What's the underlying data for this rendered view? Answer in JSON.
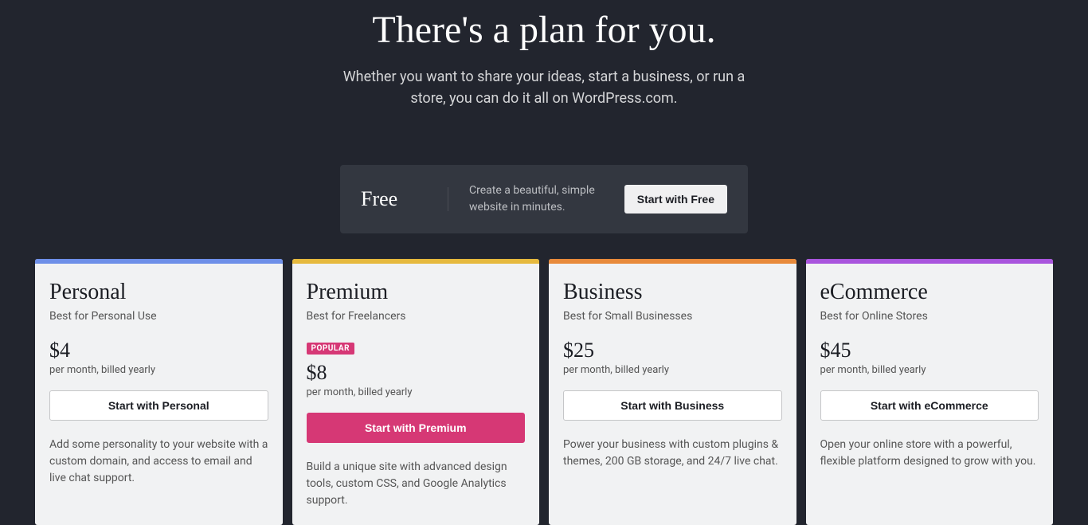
{
  "hero": {
    "title": "There's a plan for you.",
    "subtitle": "Whether you want to share your ideas, start a business, or run a store, you can do it all on WordPress.com."
  },
  "free": {
    "name": "Free",
    "desc": "Create a beautiful, simple website in minutes.",
    "cta": "Start with Free"
  },
  "plans": [
    {
      "name": "Personal",
      "tagline": "Best for Personal Use",
      "popular": false,
      "price": "$4",
      "billing": "per month, billed yearly",
      "cta": "Start with Personal",
      "desc": "Add some personality to your website with a custom domain, and access to email and live chat support.",
      "stripe": "personal-stripe",
      "highlighted": false
    },
    {
      "name": "Premium",
      "tagline": "Best for Freelancers",
      "popular": true,
      "popular_label": "POPULAR",
      "price": "$8",
      "billing": "per month, billed yearly",
      "cta": "Start with Premium",
      "desc": "Build a unique site with advanced design tools, custom CSS, and Google Analytics support.",
      "stripe": "premium-stripe",
      "highlighted": true
    },
    {
      "name": "Business",
      "tagline": "Best for Small Businesses",
      "popular": false,
      "price": "$25",
      "billing": "per month, billed yearly",
      "cta": "Start with Business",
      "desc": "Power your business with custom plugins & themes, 200 GB storage, and 24/7 live chat.",
      "stripe": "business-stripe",
      "highlighted": false
    },
    {
      "name": "eCommerce",
      "tagline": "Best for Online Stores",
      "popular": false,
      "price": "$45",
      "billing": "per month, billed yearly",
      "cta": "Start with eCommerce",
      "desc": "Open your online store with a powerful, flexible platform designed to grow with you.",
      "stripe": "ecommerce-stripe",
      "highlighted": false
    }
  ]
}
